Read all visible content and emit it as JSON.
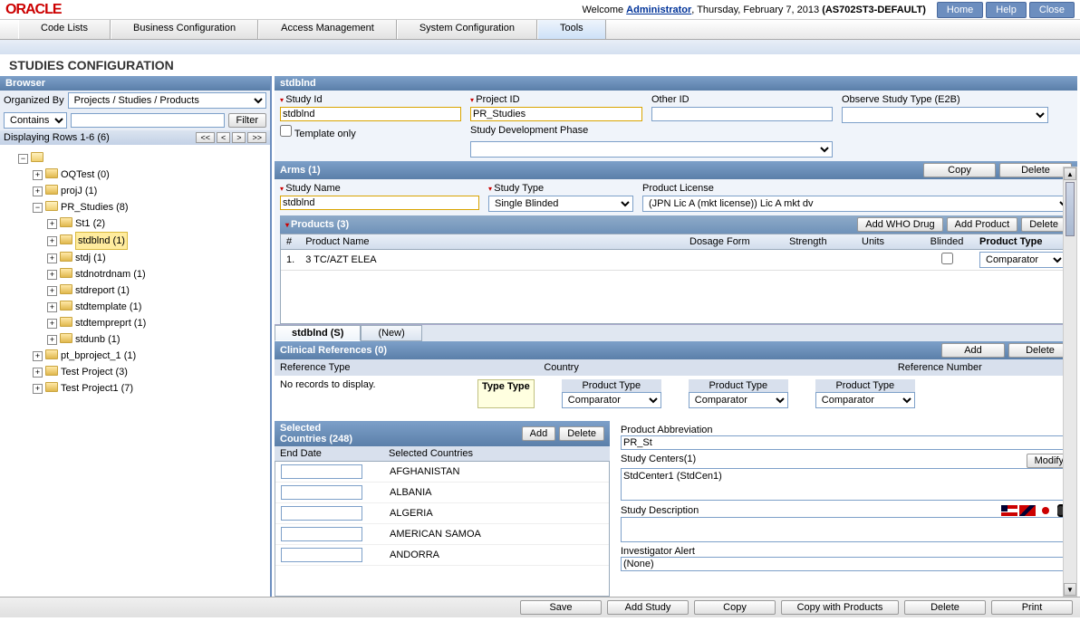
{
  "top": {
    "logo": "ORACLE",
    "welcome_pre": "Welcome ",
    "welcome_user": "Administrator",
    "welcome_date": ", Thursday, February 7, 2013 ",
    "welcome_env": "(AS702ST3-DEFAULT)",
    "home": "Home",
    "help": "Help",
    "close": "Close"
  },
  "menu": {
    "code_lists": "Code Lists",
    "biz_config": "Business Configuration",
    "access": "Access Management",
    "sys_config": "System Configuration",
    "tools": "Tools"
  },
  "page_title": "STUDIES CONFIGURATION",
  "browser": {
    "title": "Browser",
    "organized_by_lbl": "Organized By",
    "organized_by_val": "Projects / Studies / Products",
    "contains": "Contains",
    "filter": "Filter",
    "display_rows": "Displaying Rows 1-6 (6)",
    "tree": {
      "n0": "OQTest (0)",
      "n1": "projJ (1)",
      "n2": "PR_Studies (8)",
      "n2_0": "St1 (2)",
      "n2_1": "stdblnd (1)",
      "n2_2": "stdj (1)",
      "n2_3": "stdnotrdnam (1)",
      "n2_4": "stdreport (1)",
      "n2_5": "stdtemplate (1)",
      "n2_6": "stdtempreprt (1)",
      "n2_7": "stdunb (1)",
      "n3": "pt_bproject_1 (1)",
      "n4": "Test Project (3)",
      "n5": "Test Project1 (7)"
    }
  },
  "detail": {
    "header": "stdblnd",
    "study_id_lbl": "Study Id",
    "study_id_val": "stdblnd",
    "project_id_lbl": "Project ID",
    "project_id_val": "PR_Studies",
    "other_id_lbl": "Other ID",
    "other_id_val": "",
    "observe_lbl": "Observe Study Type (E2B)",
    "observe_val": "",
    "template_lbl": "Template only",
    "phase_lbl": "Study Development Phase",
    "phase_val": ""
  },
  "arms": {
    "title": "Arms (1)",
    "copy": "Copy",
    "delete": "Delete",
    "study_name_lbl": "Study Name",
    "study_name_val": "stdblnd",
    "study_type_lbl": "Study Type",
    "study_type_val": "Single Blinded",
    "license_lbl": "Product License",
    "license_val": "(JPN Lic A  (mkt license)) Lic A  mkt dv"
  },
  "products": {
    "title": "Products (3)",
    "add_who": "Add WHO Drug",
    "add_prod": "Add Product",
    "delete": "Delete",
    "col_num": "#",
    "col_name": "Product Name",
    "col_dosage": "Dosage Form",
    "col_strength": "Strength",
    "col_units": "Units",
    "col_blinded": "Blinded",
    "col_type": "Product Type",
    "row1_num": "1.",
    "row1_name": "3 TC/AZT ELEA",
    "row1_type": "Comparator"
  },
  "tabs": {
    "t1": "stdblnd (S)",
    "t2": "(New)"
  },
  "clinrefs": {
    "title": "Clinical References (0)",
    "add": "Add",
    "delete": "Delete",
    "col_ref_type": "Reference Type",
    "col_country": "Country",
    "col_ref_num": "Reference Number",
    "empty": "No records to display.",
    "type_tip": "Type Type",
    "pt_lbl": "Product Type",
    "pt_val": "Comparator"
  },
  "countries": {
    "title_l1": "Selected",
    "title_l2": "Countries (248)",
    "add": "Add",
    "delete": "Delete",
    "col_end": "End Date",
    "col_sel": "Selected Countries",
    "rows": [
      "AFGHANISTAN",
      "ALBANIA",
      "ALGERIA",
      "AMERICAN SAMOA",
      "ANDORRA"
    ]
  },
  "right": {
    "abbrev_lbl": "Product Abbreviation",
    "abbrev_val": "PR_St",
    "centers_lbl": "Study Centers(1)",
    "centers_val": "StdCenter1 (StdCen1)",
    "modify": "Modify",
    "desc_lbl": "Study Description",
    "desc_val": "",
    "alert_lbl": "Investigator Alert",
    "alert_val": "(None)"
  },
  "bottom": {
    "save": "Save",
    "add_study": "Add Study",
    "copy": "Copy",
    "copy_prod": "Copy with Products",
    "delete": "Delete",
    "print": "Print"
  }
}
